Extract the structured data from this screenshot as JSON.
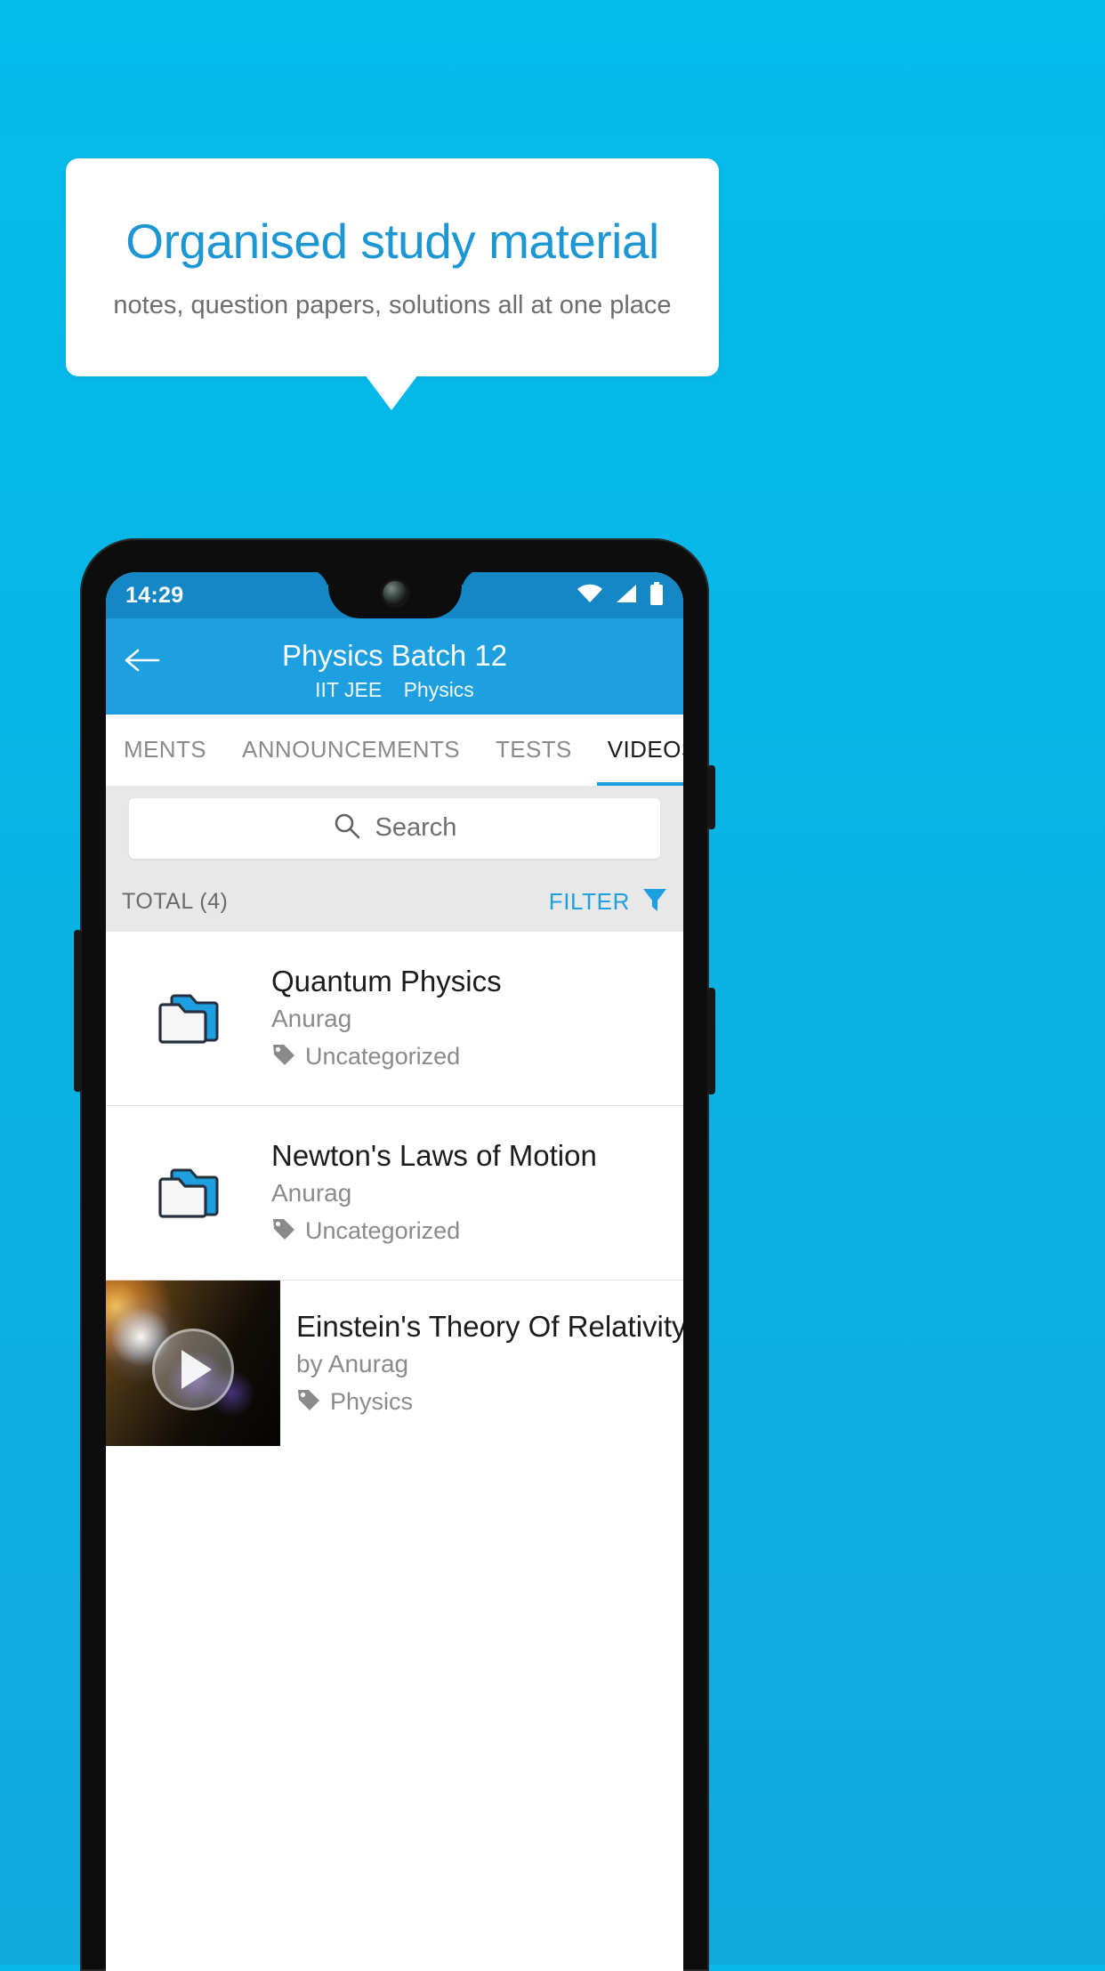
{
  "promo": {
    "title": "Organised study material",
    "subtitle": "notes, question papers, solutions all at one place",
    "title_color": "#1d96d4",
    "background_color": "#07b7e8"
  },
  "phone": {
    "statusbar": {
      "time": "14:29",
      "icons": [
        "wifi-icon",
        "signal-icon",
        "battery-icon"
      ]
    },
    "appbar": {
      "back_icon": "arrow-left-icon",
      "title": "Physics Batch 12",
      "subtitle_exam": "IIT JEE",
      "subtitle_subject": "Physics",
      "color": "#1d9fe0"
    },
    "tabs": [
      {
        "label": "MENTS",
        "active": false
      },
      {
        "label": "ANNOUNCEMENTS",
        "active": false
      },
      {
        "label": "TESTS",
        "active": false
      },
      {
        "label": "VIDEOS",
        "active": true
      }
    ],
    "search": {
      "placeholder": "Search",
      "icon": "search-icon"
    },
    "toolbar": {
      "total_label": "TOTAL (4)",
      "filter_label": "FILTER",
      "filter_icon": "funnel-icon",
      "accent_color": "#1d9fe0"
    },
    "list": [
      {
        "icon": "folder-icon",
        "title": "Quantum Physics",
        "author": "Anurag",
        "tag_icon": "tag-icon",
        "tag": "Uncategorized"
      },
      {
        "icon": "folder-icon",
        "title": "Newton's Laws of Motion",
        "author": "Anurag",
        "tag_icon": "tag-icon",
        "tag": "Uncategorized"
      },
      {
        "icon": "video-thumbnail",
        "play_icon": "play-icon",
        "title": "Einstein's Theory Of Relativity",
        "author": "by Anurag",
        "tag_icon": "tag-icon",
        "tag": "Physics"
      }
    ]
  }
}
